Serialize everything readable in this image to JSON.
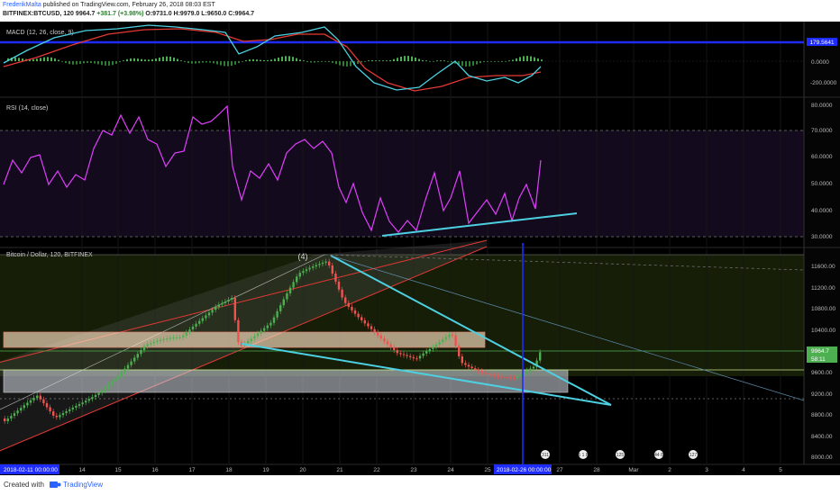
{
  "header": {
    "author": "FrederikMalta",
    "publish_text": "published on TradingView.com, February 26, 2018 08:03 EST",
    "symbol": "BITFINEX:BTCUSD, 120",
    "last": "9964.7",
    "change": "+381.7 (+3.98%)",
    "open": "O:9731.0",
    "high": "H:9979.0",
    "low": "L:9650.0",
    "close": "C:9964.7"
  },
  "colors": {
    "background": "#000000",
    "up_candle": "#4caf50",
    "down_candle": "#ef5350",
    "macd_line": "#4dd0e1",
    "signal_line": "#e53935",
    "rsi_line": "#e040fb",
    "trendline": "#4dd0e1",
    "hline_blue": "#1f2cff"
  },
  "panels": {
    "macd": {
      "title": "MACD (12, 26, close, 9)",
      "badge": "179.5641",
      "ticks": [
        "0.0000",
        "-200.0000"
      ]
    },
    "rsi": {
      "title": "RSI (14, close)",
      "ticks": [
        "80.0000",
        "70.0000",
        "60.0000",
        "50.0000",
        "40.0000",
        "30.0000"
      ]
    },
    "price": {
      "title": "Bitcoin / Dollar, 120, BITFINEX",
      "wave_label": "(4)",
      "badge_price": "9964.7",
      "badge_countdown": "58:11",
      "ticks": [
        "11600.00",
        "11200.00",
        "10800.00",
        "10400.00",
        "9600.00",
        "9200.00",
        "8800.00",
        "8400.00",
        "8000.00"
      ]
    }
  },
  "events": [
    "311",
    "5 1 8",
    "125",
    "44 8",
    "127"
  ],
  "xaxis": {
    "start_badge": "2018-02-11 00:00:00",
    "cursor_badge": "2018-02-26 00:00:00",
    "labels": [
      "14",
      "15",
      "16",
      "17",
      "18",
      "19",
      "20",
      "21",
      "22",
      "23",
      "24",
      "25",
      "27",
      "28",
      "Mar",
      "2",
      "3",
      "4",
      "5"
    ]
  },
  "footer": {
    "created_with": "Created with",
    "brand": "TradingView"
  },
  "chart_data": {
    "type": "candlestick",
    "title": "Bitcoin / Dollar, 120, BITFINEX",
    "x_range": [
      "2018-02-11",
      "2018-03-05"
    ],
    "price_range": [
      7900,
      11850
    ],
    "close_path": [
      [
        "2018-02-11",
        8300
      ],
      [
        "2018-02-12",
        8800
      ],
      [
        "2018-02-13",
        8600
      ],
      [
        "2018-02-14",
        9300
      ],
      [
        "2018-02-15",
        10000
      ],
      [
        "2018-02-16",
        10100
      ],
      [
        "2018-02-17",
        10800
      ],
      [
        "2018-02-18",
        11100
      ],
      [
        "2018-02-18 12:00",
        10300
      ],
      [
        "2018-02-19",
        10700
      ],
      [
        "2018-02-20",
        11500
      ],
      [
        "2018-02-20 12:00",
        11750
      ],
      [
        "2018-02-21",
        11300
      ],
      [
        "2018-02-22",
        10600
      ],
      [
        "2018-02-23",
        9900
      ],
      [
        "2018-02-24",
        10000
      ],
      [
        "2018-02-24 12:00",
        10300
      ],
      [
        "2018-02-25",
        9700
      ],
      [
        "2018-02-26",
        9600
      ],
      [
        "2018-02-26 08:00",
        9964.7
      ]
    ],
    "rsi": {
      "levels": [
        70,
        30
      ],
      "range": [
        27,
        82
      ],
      "path": [
        [
          "2018-02-11",
          45
        ],
        [
          "2018-02-12",
          57
        ],
        [
          "2018-02-13",
          50
        ],
        [
          "2018-02-14",
          68
        ],
        [
          "2018-02-15",
          72
        ],
        [
          "2018-02-16",
          60
        ],
        [
          "2018-02-17",
          73
        ],
        [
          "2018-02-18",
          80
        ],
        [
          "2018-02-18 12:00",
          50
        ],
        [
          "2018-02-19",
          55
        ],
        [
          "2018-02-20",
          66
        ],
        [
          "2018-02-21",
          62
        ],
        [
          "2018-02-21 12:00",
          50
        ],
        [
          "2018-02-22",
          36
        ],
        [
          "2018-02-23",
          32
        ],
        [
          "2018-02-24",
          46
        ],
        [
          "2018-02-24 12:00",
          38
        ],
        [
          "2018-02-25",
          40
        ],
        [
          "2018-02-26",
          44
        ],
        [
          "2018-02-26 08:00",
          58
        ]
      ]
    },
    "macd": {
      "range": [
        -250,
        260
      ],
      "path": [
        [
          "2018-02-11",
          0
        ],
        [
          "2018-02-13",
          150
        ],
        [
          "2018-02-15",
          200
        ],
        [
          "2018-02-17",
          190
        ],
        [
          "2018-02-18",
          60
        ],
        [
          "2018-02-19",
          120
        ],
        [
          "2018-02-20",
          190
        ],
        [
          "2018-02-21",
          100
        ],
        [
          "2018-02-22",
          -120
        ],
        [
          "2018-02-23",
          -220
        ],
        [
          "2018-02-24",
          -120
        ],
        [
          "2018-02-25",
          -150
        ],
        [
          "2018-02-26",
          -140
        ],
        [
          "2018-02-26 08:00",
          -60
        ]
      ]
    }
  }
}
